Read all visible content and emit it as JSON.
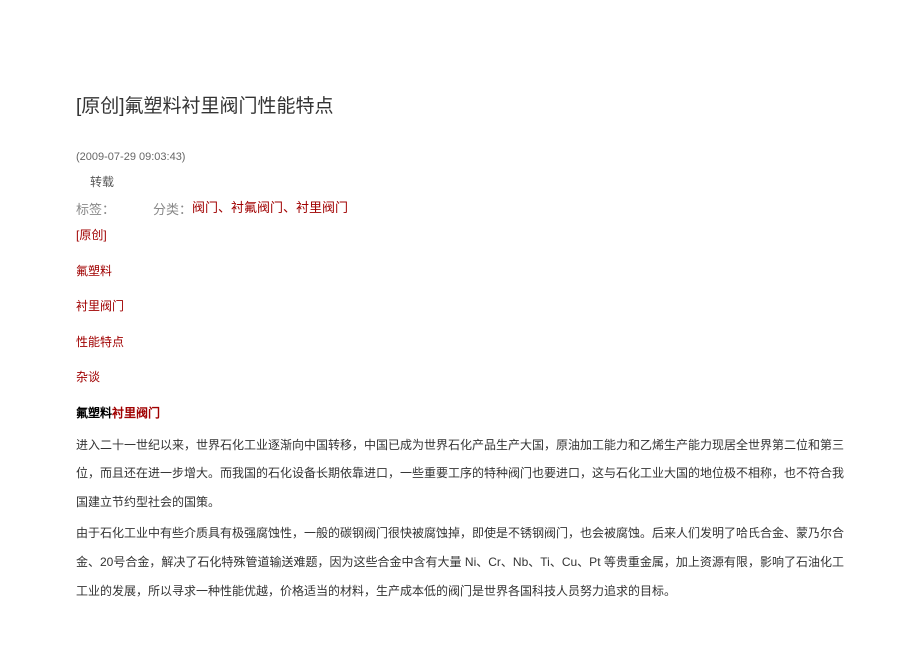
{
  "title": "[原创]氟塑料衬里阀门性能特点",
  "timestamp": "(2009-07-29 09:03:43)",
  "reprint_label": "转载",
  "tags_label": "标签：",
  "category_label": "分类：",
  "category_value": "阀门、衬氟阀门、衬里阀门",
  "tags": [
    "[原创]",
    "氟塑料",
    "衬里阀门",
    "性能特点",
    "杂谈"
  ],
  "article_label": {
    "black_part": "氟塑料",
    "red_part": "衬里阀门"
  },
  "paragraphs": [
    "进入二十一世纪以来，世界石化工业逐渐向中国转移，中国已成为世界石化产品生产大国，原油加工能力和乙烯生产能力现居全世界第二位和第三位，而且还在进一步增大。而我国的石化设备长期依靠进口，一些重要工序的特种阀门也要进口，这与石化工业大国的地位极不相称，也不符合我国建立节约型社会的国策。",
    "由于石化工业中有些介质具有极强腐蚀性，一般的碳钢阀门很快被腐蚀掉，即使是不锈钢阀门，也会被腐蚀。后来人们发明了哈氏合金、蒙乃尔合金、20号合金，解决了石化特殊管道输送难题，因为这些合金中含有大量 Ni、Cr、Nb、Ti、Cu、Pt 等贵重金属，加上资源有限，影响了石油化工工业的发展，所以寻求一种性能优越，价格适当的材料，生产成本低的阀门是世界各国科技人员努力追求的目标。"
  ]
}
